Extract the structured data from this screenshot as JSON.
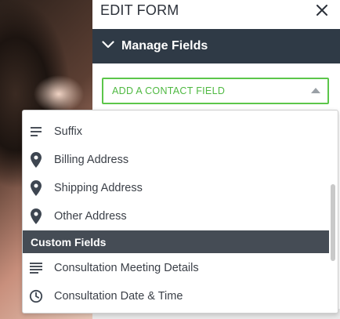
{
  "panel": {
    "title": "EDIT FORM",
    "section_title": "Manage Fields",
    "add_field_label": "ADD A CONTACT FIELD"
  },
  "dropdown": {
    "items": [
      {
        "label": "Suffix",
        "icon": "short-text-icon"
      },
      {
        "label": "Billing Address",
        "icon": "map-pin-icon"
      },
      {
        "label": "Shipping Address",
        "icon": "map-pin-icon"
      },
      {
        "label": "Other Address",
        "icon": "map-pin-icon"
      }
    ],
    "group_label": "Custom Fields",
    "custom_items": [
      {
        "label": "Consultation Meeting Details",
        "icon": "paragraph-icon"
      },
      {
        "label": "Consultation Date & Time",
        "icon": "clock-icon"
      }
    ]
  },
  "colors": {
    "section_bar": "#2f3a46",
    "accent_green": "#5cc64a",
    "group_bar": "#454c55"
  }
}
